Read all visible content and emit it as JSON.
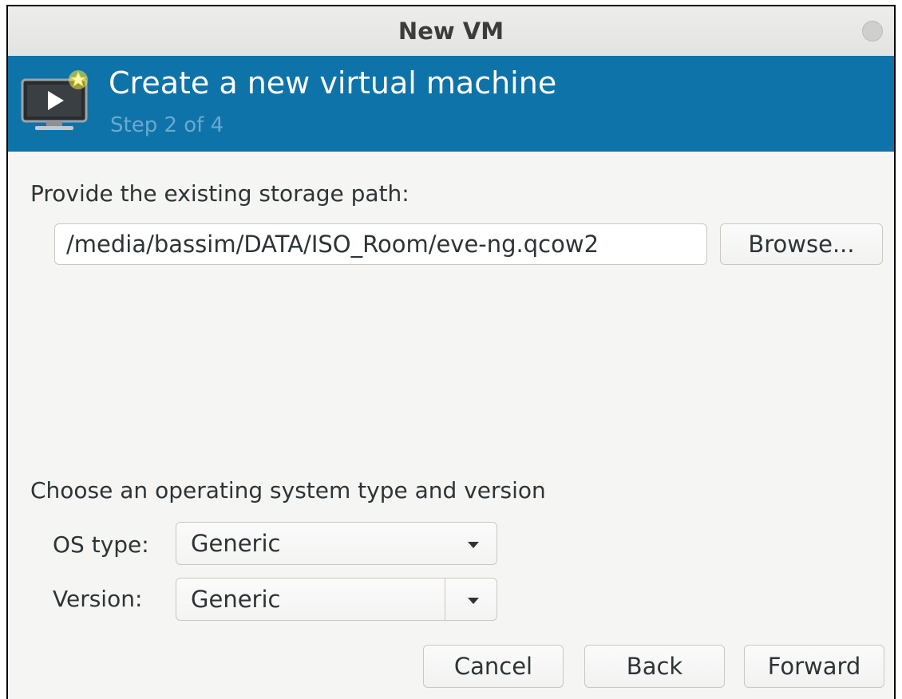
{
  "window": {
    "title": "New VM"
  },
  "banner": {
    "title": "Create a new virtual machine",
    "step": "Step 2 of 4",
    "icon": "new-vm-monitor-icon"
  },
  "storage": {
    "label": "Provide the existing storage path:",
    "path_value": "/media/bassim/DATA/ISO_Room/eve-ng.qcow2",
    "browse_label": "Browse..."
  },
  "os": {
    "section_label": "Choose an operating system type and version",
    "type_label": "OS type:",
    "type_value": "Generic",
    "version_label": "Version:",
    "version_value": "Generic"
  },
  "buttons": {
    "cancel": "Cancel",
    "back": "Back",
    "forward": "Forward"
  },
  "colors": {
    "banner": "#0e73a8",
    "banner_subtitle": "#6aa9d0",
    "window_bg": "#f5f5f4"
  }
}
